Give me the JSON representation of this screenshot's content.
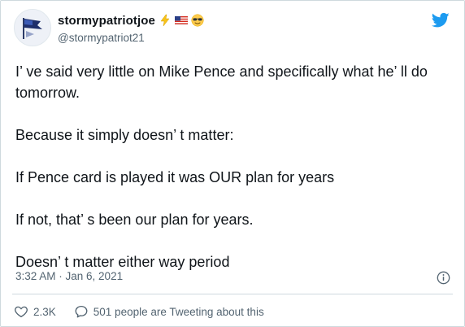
{
  "user": {
    "display_name": "stormypatriotjoe",
    "handle": "@stormypatriot21",
    "avatar_icon": "flag-avatar-icon",
    "name_emojis": [
      "lightning-bolt-emoji",
      "us-flag-emoji",
      "sunglasses-emoji"
    ]
  },
  "tweet": {
    "lines": [
      "I’ ve said very little on Mike Pence and specifically what he’ ll do tomorrow.",
      "Because it simply doesn’ t matter:",
      "If Pence card is played it was OUR plan for years",
      "If not, that’ s been our plan for years.",
      "Doesn’ t matter either way period"
    ],
    "timestamp": "3:32 AM · Jan 6, 2021"
  },
  "actions": {
    "likes": "2.3K",
    "replies_label": "501 people are Tweeting about this"
  },
  "colors": {
    "text": "#0f1419",
    "secondary": "#536471",
    "twitter_blue": "#1d9bf0",
    "border": "#cfd9de"
  },
  "icons": {
    "brand": "twitter-bird-icon",
    "info": "info-icon",
    "like": "heart-icon",
    "reply": "speech-bubble-icon"
  }
}
